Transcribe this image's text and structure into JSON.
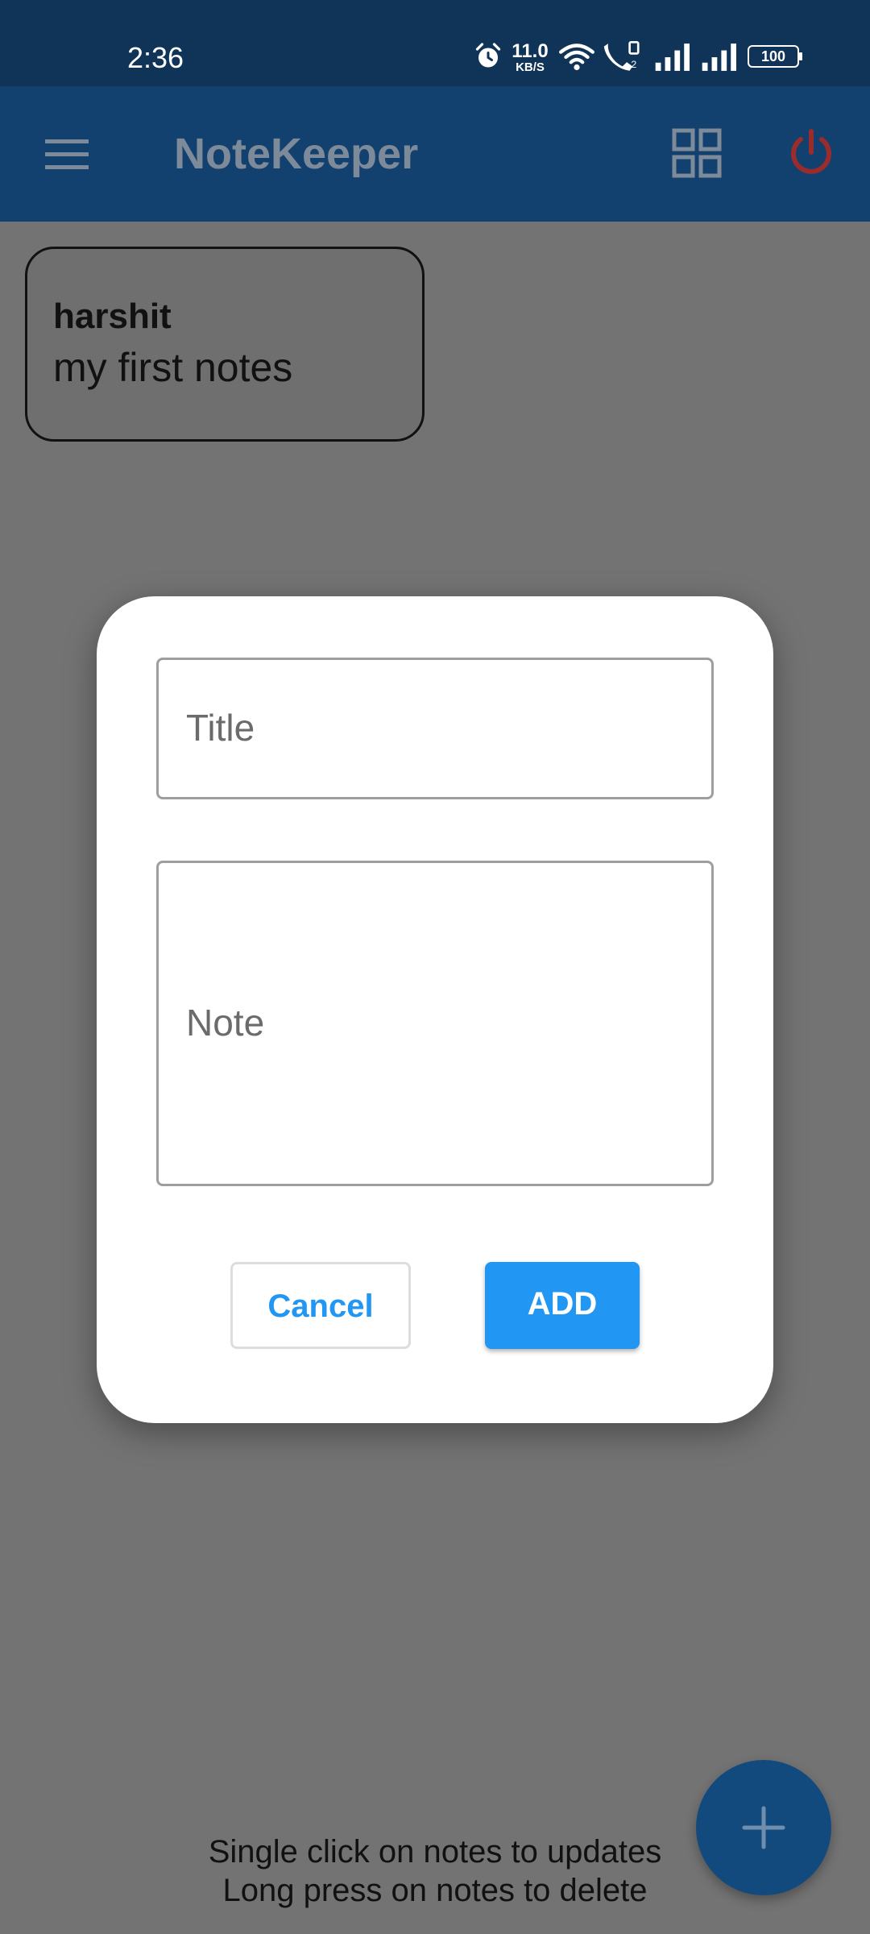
{
  "status_bar": {
    "time": "2:36",
    "net_speed_value": "11.0",
    "net_speed_unit": "KB/S",
    "battery": "100",
    "icons": [
      "alarm-icon",
      "wifi-icon",
      "call-icon",
      "signal-icon",
      "signal-icon",
      "battery-icon"
    ]
  },
  "app_bar": {
    "title": "NoteKeeper",
    "icons": [
      "menu-icon",
      "grid-view-icon",
      "power-icon"
    ]
  },
  "notes": [
    {
      "title": "harshit",
      "body": "my first notes"
    }
  ],
  "dialog": {
    "title_placeholder": "Title",
    "note_placeholder": "Note",
    "cancel_label": "Cancel",
    "add_label": "ADD"
  },
  "hints": {
    "line1": "Single click on notes to updates",
    "line2": "Long press on notes to delete"
  },
  "fab": {
    "icon": "add-icon"
  },
  "colors": {
    "status_bar": "#0f3457",
    "app_bar": "#124170",
    "scrim": "#737373",
    "accent": "#2196f3",
    "power_icon": "#9b2c2c",
    "fab": "#124a7e"
  }
}
